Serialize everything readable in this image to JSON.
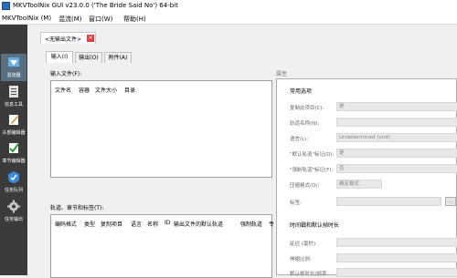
{
  "window": {
    "title": "MKVToolNix GUI v23.0.0 ('The Bride Said No') 64-bit"
  },
  "menu": [
    {
      "label": "MKVToolNix (M)"
    },
    {
      "label": "混流(M)"
    },
    {
      "label": "窗口(W)"
    },
    {
      "label": "帮助(H)"
    }
  ],
  "sidebar": [
    {
      "label": "混流器",
      "icon": "mux-icon"
    },
    {
      "label": "信息工具",
      "icon": "info-tool-icon"
    },
    {
      "label": "头部编辑器",
      "icon": "header-editor-icon"
    },
    {
      "label": "章节编辑器",
      "icon": "chapter-editor-icon"
    },
    {
      "label": "任务队列",
      "icon": "job-queue-icon"
    },
    {
      "label": "任务输出",
      "icon": "job-output-icon"
    }
  ],
  "file_tab": {
    "label": "<无输出文件>",
    "close": "×"
  },
  "subtabs": [
    {
      "label": "输入(I)"
    },
    {
      "label": "输出(O)"
    },
    {
      "label": "附件(A)"
    }
  ],
  "input_files": {
    "label": "输入文件(F):",
    "columns": [
      "文件名",
      "容器",
      "文件大小",
      "目录"
    ]
  },
  "tracks": {
    "label": "轨道、章节和标签(T):",
    "columns": [
      "编码格式",
      "类型",
      "复制项目",
      "语言",
      "名称",
      "ID",
      "输出文件的默认轨道",
      "强制轨道",
      "专"
    ]
  },
  "properties": {
    "label": "属性",
    "general_title": "常用选项",
    "fields": [
      {
        "label": "复制此项目(C):",
        "value": "是"
      },
      {
        "label": "轨道名称(N):",
        "value": ""
      },
      {
        "label": "语言(L):",
        "value": "Undetermined (und)"
      },
      {
        "label": "\"默认轨道\"标记(D):",
        "value": "是"
      },
      {
        "label": "\"强制轨道\"标记(F):",
        "value": "否"
      },
      {
        "label": "压缩格式(O):",
        "value": "确定格式"
      },
      {
        "label": "标签:",
        "value": "",
        "button": "..."
      }
    ],
    "timing_title": "时间戳和默认帧时长",
    "timing_fields": [
      {
        "label": "延迟 (毫秒):",
        "value": ""
      },
      {
        "label": "伸缩比例:",
        "value": ""
      },
      {
        "label": "默认帧时长/帧率:",
        "value": ""
      }
    ]
  }
}
